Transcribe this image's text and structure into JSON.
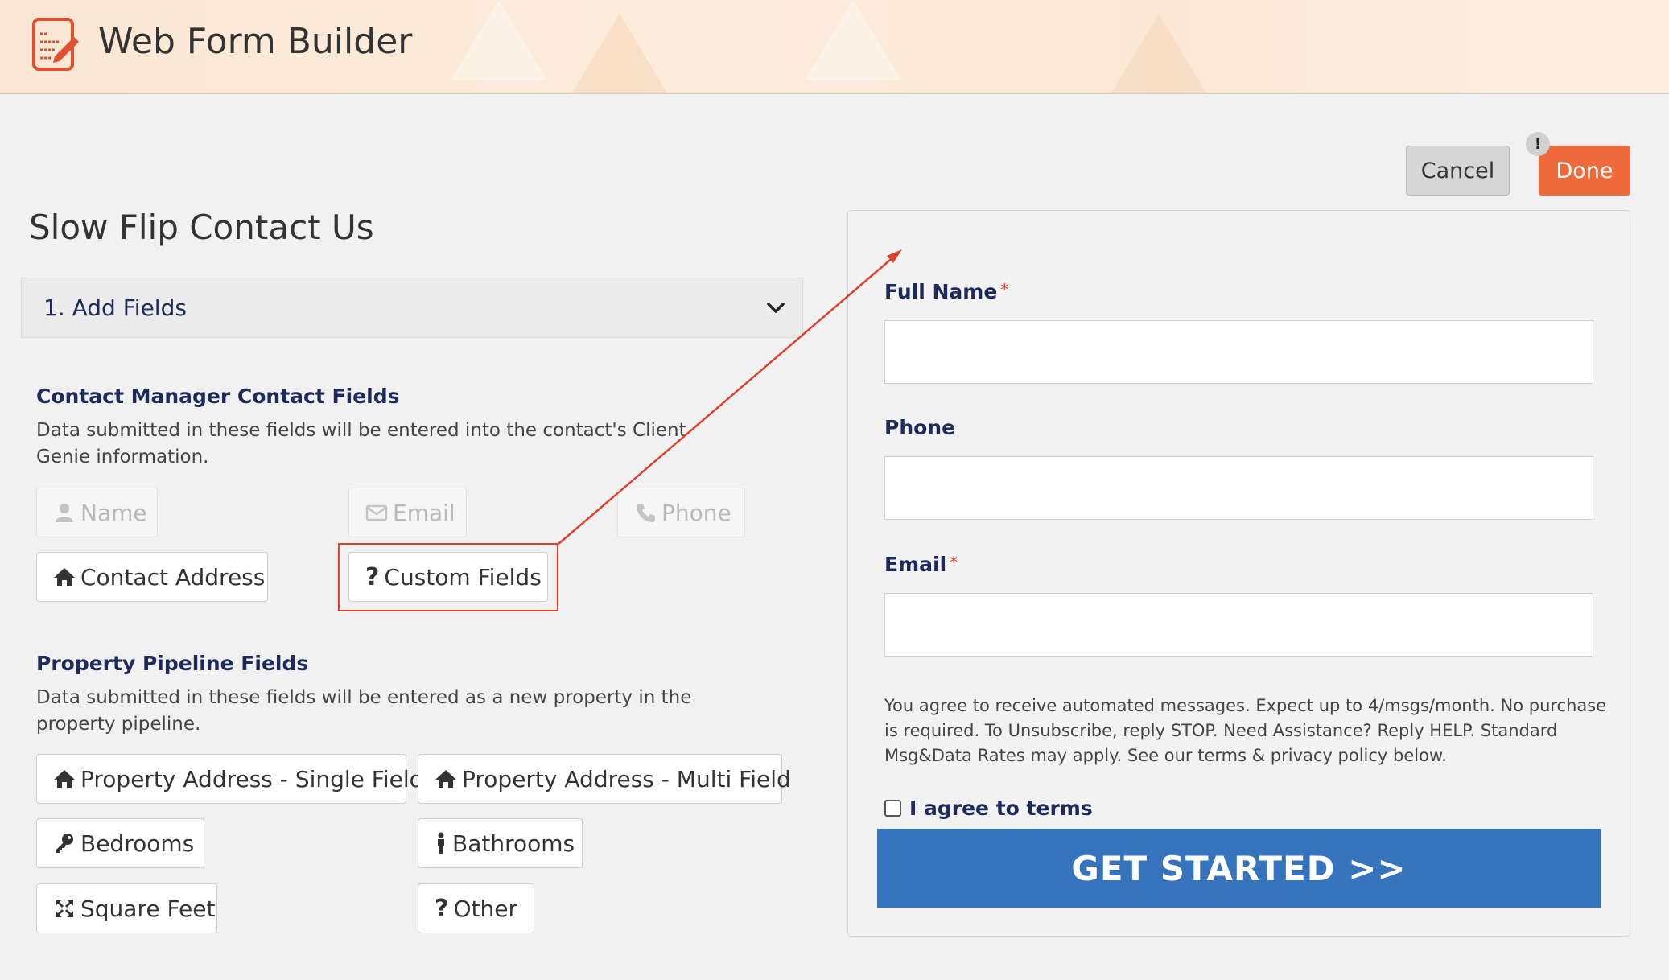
{
  "header": {
    "app_title": "Web Form Builder",
    "logo_icon": "form-edit-icon",
    "accent": "#ee6a3a"
  },
  "page_title": "Slow Flip Contact Us",
  "actions": {
    "cancel_label": "Cancel",
    "done_label": "Done",
    "warning_badge": "!"
  },
  "accordion": {
    "label": "1. Add Fields",
    "chevron_icon": "chevron-down-icon"
  },
  "contact_section": {
    "title": "Contact Manager Contact Fields",
    "description": "Data submitted in these fields will be entered into the contact's Client Genie information.",
    "fields": [
      {
        "label": "Name",
        "icon": "user-icon",
        "enabled": false
      },
      {
        "label": "Email",
        "icon": "envelope-icon",
        "enabled": false
      },
      {
        "label": "Phone",
        "icon": "phone-icon",
        "enabled": false
      },
      {
        "label": "Contact Address",
        "icon": "home-icon",
        "enabled": true
      },
      {
        "label": "Custom Fields",
        "icon": "question-icon",
        "enabled": true,
        "highlighted": true
      }
    ]
  },
  "property_section": {
    "title": "Property Pipeline Fields",
    "description": "Data submitted in these fields will be entered as a new property in the property pipeline.",
    "fields": [
      {
        "label": "Property Address - Single Field",
        "icon": "home-icon"
      },
      {
        "label": "Property Address - Multi Field",
        "icon": "home-icon"
      },
      {
        "label": "Bedrooms",
        "icon": "key-icon"
      },
      {
        "label": "Bathrooms",
        "icon": "person-icon"
      },
      {
        "label": "Square Feet",
        "icon": "expand-icon"
      },
      {
        "label": "Other",
        "icon": "question-icon"
      }
    ]
  },
  "preview_form": {
    "fields": [
      {
        "label": "Full Name",
        "required": true,
        "required_mark": "*",
        "value": ""
      },
      {
        "label": "Phone",
        "required": false,
        "value": ""
      },
      {
        "label": "Email",
        "required": true,
        "required_mark": "*",
        "value": ""
      }
    ],
    "consent_text": "You agree to receive automated messages. Expect up to 4/msgs/month. No purchase is required. To Unsubscribe, reply STOP. Need Assistance? Reply HELP. Standard Msg&Data Rates may apply. See our terms & privacy policy below.",
    "agree_label": "I agree to terms",
    "agree_checked": false,
    "submit_label": "GET STARTED >>",
    "submit_color": "#3573bc"
  },
  "annotation": {
    "color": "#d9432f"
  }
}
